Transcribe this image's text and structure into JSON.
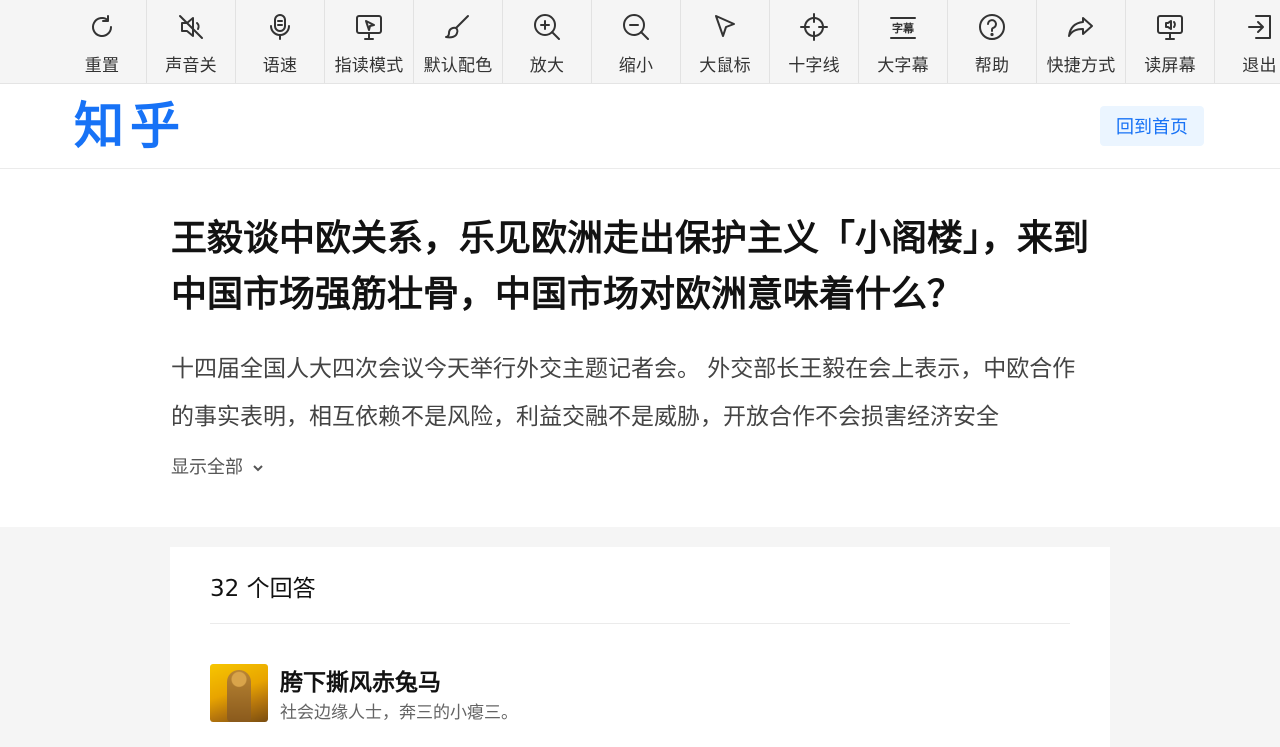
{
  "toolbar": {
    "items": [
      {
        "label": "重置",
        "icon": "refresh-icon"
      },
      {
        "label": "声音关",
        "icon": "sound-off-icon"
      },
      {
        "label": "语速",
        "icon": "microphone-icon"
      },
      {
        "label": "指读模式",
        "icon": "point-read-icon"
      },
      {
        "label": "默认配色",
        "icon": "brush-icon"
      },
      {
        "label": "放大",
        "icon": "zoom-in-icon"
      },
      {
        "label": "缩小",
        "icon": "zoom-out-icon"
      },
      {
        "label": "大鼠标",
        "icon": "cursor-icon"
      },
      {
        "label": "十字线",
        "icon": "crosshair-icon"
      },
      {
        "label": "大字幕",
        "icon": "subtitle-icon"
      },
      {
        "label": "帮助",
        "icon": "help-icon"
      },
      {
        "label": "快捷方式",
        "icon": "share-arrow-icon"
      },
      {
        "label": "读屏幕",
        "icon": "screen-reader-icon"
      },
      {
        "label": "退出",
        "icon": "exit-icon"
      }
    ],
    "subtitle_icon_text": "字幕"
  },
  "header": {
    "logo": "知乎",
    "home_button": "回到首页"
  },
  "question": {
    "title": "王毅谈中欧关系，乐见欧洲走出保护主义「小阁楼」，来到中国市场强筋壮骨，中国市场对欧洲意味着什么？",
    "excerpt": "十四届全国人大四次会议今天举行外交主题记者会。 外交部长王毅在会上表示，中欧合作的事实表明，相互依赖不是风险，利益交融不是威胁，开放合作不会损害经济安全",
    "show_all": "显示全部"
  },
  "answers": {
    "count_label": "32 个回答",
    "first": {
      "author_name": "胯下撕风赤兔马",
      "author_desc": "社会边缘人士，奔三的小瘪三。"
    }
  },
  "colors": {
    "brand": "#1772f6",
    "home_button_bg": "#ebf5ff",
    "page_bg": "#f5f5f5"
  }
}
